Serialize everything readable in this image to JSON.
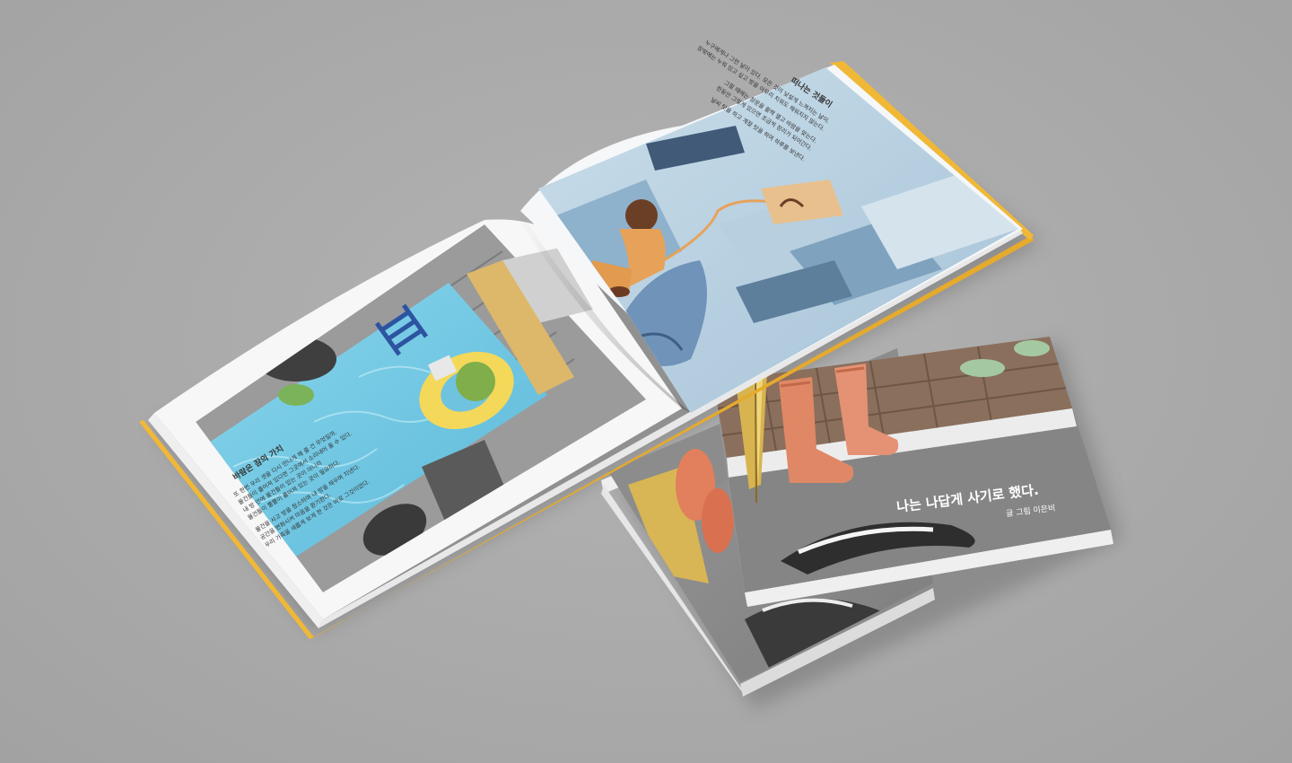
{
  "scene": {
    "background_color": "#acacac",
    "spine_color": "#f0b836"
  },
  "open_book": {
    "left_page": {
      "heading": "바람은 잠의 가치",
      "body_lines": [
        "또 한번 우리 셋을 다시 만나게 해 줄 건 무엇일까.",
        "물건들이 흩어져 있다면 그곳에서 소리내어 울 수 있다.",
        "내 방 안에 물건들이 있는 곳이 아니라",
        "물건들이 뿔뿔이 흩어져 있는 곳이 필요하다.",
        "물건을 사고 방을 청소하며 내 방을 채우며 지낸다.",
        "공간을 변화시켜 마음을 환기한다.",
        "우리 가족을 새롭게 보게 한 것은 바로 그것이었다."
      ]
    },
    "right_page": {
      "heading": "떠나는 것들이",
      "body_lines": [
        "누구에게나 그런 날이 있다. 모든 것이 낯설게 느껴지는 날이.",
        "창밖에는 누워 있고 싶고 방을 아무리 치워도 채워지지 않는다.",
        "그럴 때에는 창문을 활짝 열고 바람을 맞는다.",
        "한동안 그렇게 있으면 조금씩 정리가 되어간다.",
        "날씨 탓을 하고 계절 탓을 하며 하루를 보낸다."
      ]
    }
  },
  "cover": {
    "title": "나는 나답게 사기로 했다.",
    "subtitle": "글 그림 이은비"
  },
  "icons": [
    "umbrella-icon",
    "rain-boots-icon",
    "swim-ring-icon",
    "pool-ladder-icon"
  ]
}
